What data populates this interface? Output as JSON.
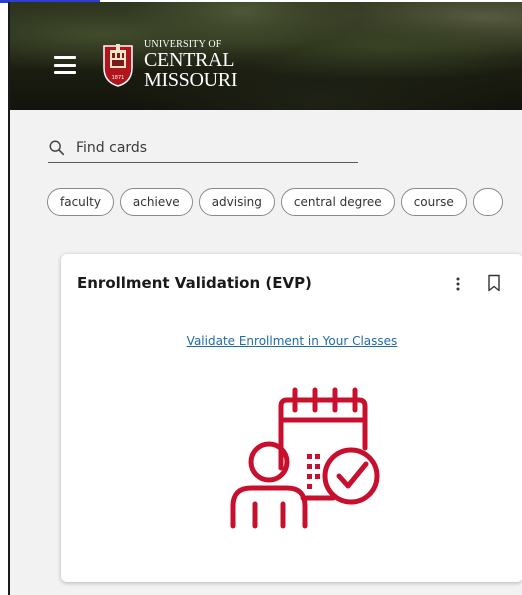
{
  "header": {
    "logo": {
      "line1": "UNIVERSITY OF",
      "line2": "CENTRAL",
      "line3": "MISSOURI",
      "seal_year": "1871"
    }
  },
  "search": {
    "placeholder": "Find cards"
  },
  "chips": [
    "faculty",
    "achieve",
    "advising",
    "central degree",
    "course"
  ],
  "card": {
    "title": "Enrollment Validation (EVP)",
    "link": "Validate Enrollment in Your Classes",
    "icon": "calendar-person-check-icon",
    "accent_color": "#c8102e"
  },
  "colors": {
    "link": "#1f6aa8",
    "accent": "#c8102e"
  }
}
